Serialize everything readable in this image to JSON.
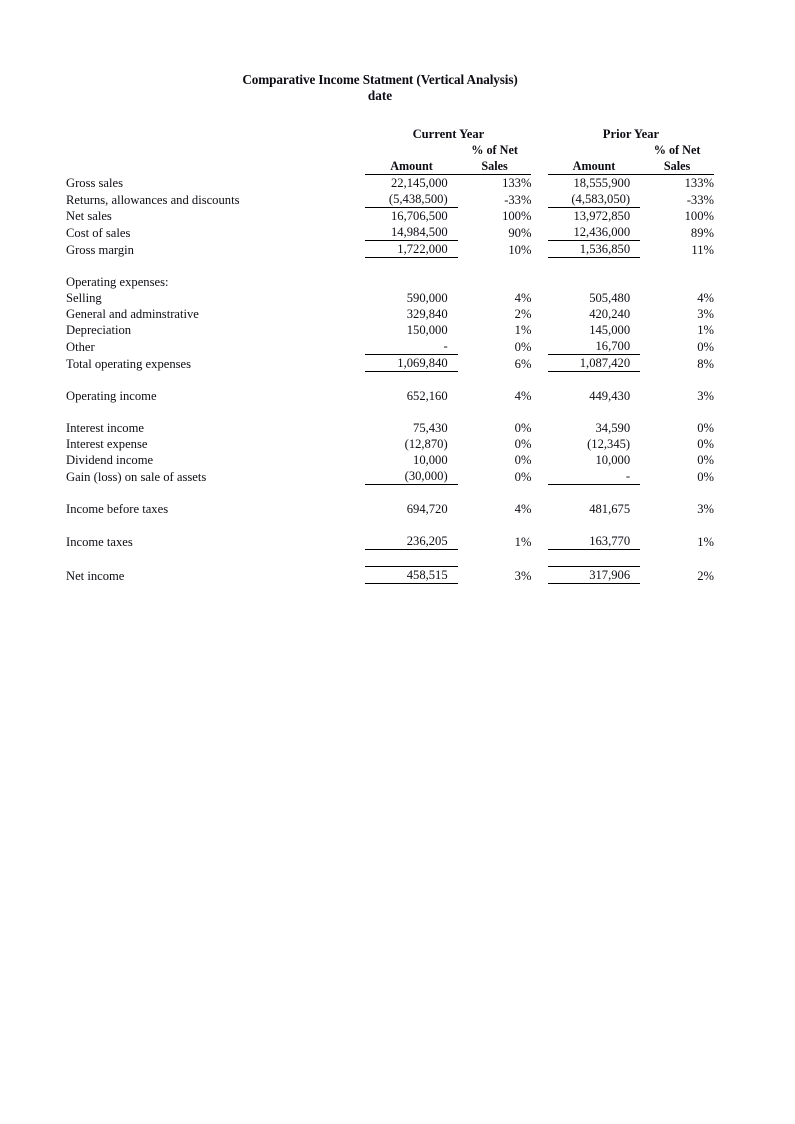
{
  "document": {
    "title": "Comparative Income Statment (Vertical Analysis)",
    "subtitle": "date"
  },
  "columns": {
    "group_current": "Current Year",
    "group_prior": "Prior Year",
    "amount_header": "Amount",
    "pct_header_line1": "% of Net",
    "pct_header_line2": "Sales"
  },
  "rows": [
    {
      "label": "Gross sales",
      "indent": 0,
      "current_amount": "22,145,000",
      "current_pct": "133%",
      "prior_amount": "18,555,900",
      "prior_pct": "133%",
      "rule": "none",
      "bold": false
    },
    {
      "label": "Returns, allowances and discounts",
      "indent": 0,
      "current_amount": "(5,438,500)",
      "current_pct": "-33%",
      "prior_amount": "(4,583,050)",
      "prior_pct": "-33%",
      "rule": "bottom",
      "bold": false
    },
    {
      "label": "Net sales",
      "indent": 0,
      "current_amount": "16,706,500",
      "current_pct": "100%",
      "prior_amount": "13,972,850",
      "prior_pct": "100%",
      "rule": "none",
      "bold": false
    },
    {
      "label": "Cost of sales",
      "indent": 0,
      "current_amount": "14,984,500",
      "current_pct": "90%",
      "prior_amount": "12,436,000",
      "prior_pct": "89%",
      "rule": "bottom",
      "bold": false
    },
    {
      "label": "Gross margin",
      "indent": 1,
      "current_amount": "1,722,000",
      "current_pct": "10%",
      "prior_amount": "1,536,850",
      "prior_pct": "11%",
      "rule": "bottom",
      "bold": false
    },
    {
      "label": "Operating expenses:",
      "indent": 0,
      "current_amount": "",
      "current_pct": "",
      "prior_amount": "",
      "prior_pct": "",
      "rule": "none",
      "bold": false
    },
    {
      "label": "Selling",
      "indent": 1,
      "current_amount": "590,000",
      "current_pct": "4%",
      "prior_amount": "505,480",
      "prior_pct": "4%",
      "rule": "none",
      "bold": false
    },
    {
      "label": "General and adminstrative",
      "indent": 1,
      "current_amount": "329,840",
      "current_pct": "2%",
      "prior_amount": "420,240",
      "prior_pct": "3%",
      "rule": "none",
      "bold": false
    },
    {
      "label": "Depreciation",
      "indent": 1,
      "current_amount": "150,000",
      "current_pct": "1%",
      "prior_amount": "145,000",
      "prior_pct": "1%",
      "rule": "none",
      "bold": false
    },
    {
      "label": "Other",
      "indent": 1,
      "current_amount": "-",
      "current_pct": "0%",
      "prior_amount": "16,700",
      "prior_pct": "0%",
      "rule": "bottom",
      "bold": false
    },
    {
      "label": "Total operating expenses",
      "indent": 1,
      "current_amount": "1,069,840",
      "current_pct": "6%",
      "prior_amount": "1,087,420",
      "prior_pct": "8%",
      "rule": "bottom",
      "bold": false
    },
    {
      "label": "Operating income",
      "indent": 0,
      "current_amount": "652,160",
      "current_pct": "4%",
      "prior_amount": "449,430",
      "prior_pct": "3%",
      "rule": "none",
      "bold": false
    },
    {
      "label": "Interest income",
      "indent": 0,
      "current_amount": "75,430",
      "current_pct": "0%",
      "prior_amount": "34,590",
      "prior_pct": "0%",
      "rule": "none",
      "bold": false
    },
    {
      "label": "Interest expense",
      "indent": 0,
      "current_amount": "(12,870)",
      "current_pct": "0%",
      "prior_amount": "(12,345)",
      "prior_pct": "0%",
      "rule": "none",
      "bold": false
    },
    {
      "label": "Dividend income",
      "indent": 0,
      "current_amount": "10,000",
      "current_pct": "0%",
      "prior_amount": "10,000",
      "prior_pct": "0%",
      "rule": "none",
      "bold": false
    },
    {
      "label": "Gain (loss) on sale of assets",
      "indent": 0,
      "current_amount": "(30,000)",
      "current_pct": "0%",
      "prior_amount": "-",
      "prior_pct": "0%",
      "rule": "bottom",
      "bold": false
    },
    {
      "label": "Income before taxes",
      "indent": 0,
      "current_amount": "694,720",
      "current_pct": "4%",
      "prior_amount": "481,675",
      "prior_pct": "3%",
      "rule": "none",
      "bold": false
    },
    {
      "label": "Income taxes",
      "indent": 0,
      "current_amount": "236,205",
      "current_pct": "1%",
      "prior_amount": "163,770",
      "prior_pct": "1%",
      "rule": "bottom",
      "bold": false
    },
    {
      "label": "Net income",
      "indent": 0,
      "current_amount": "458,515",
      "current_pct": "3%",
      "prior_amount": "317,906",
      "prior_pct": "2%",
      "rule": "double",
      "bold": true
    }
  ],
  "spacers_before": [
    5,
    11,
    12,
    16,
    17,
    18
  ],
  "colors": {
    "text": "#0d0d14",
    "rule": "#000000",
    "background": "#ffffff"
  }
}
